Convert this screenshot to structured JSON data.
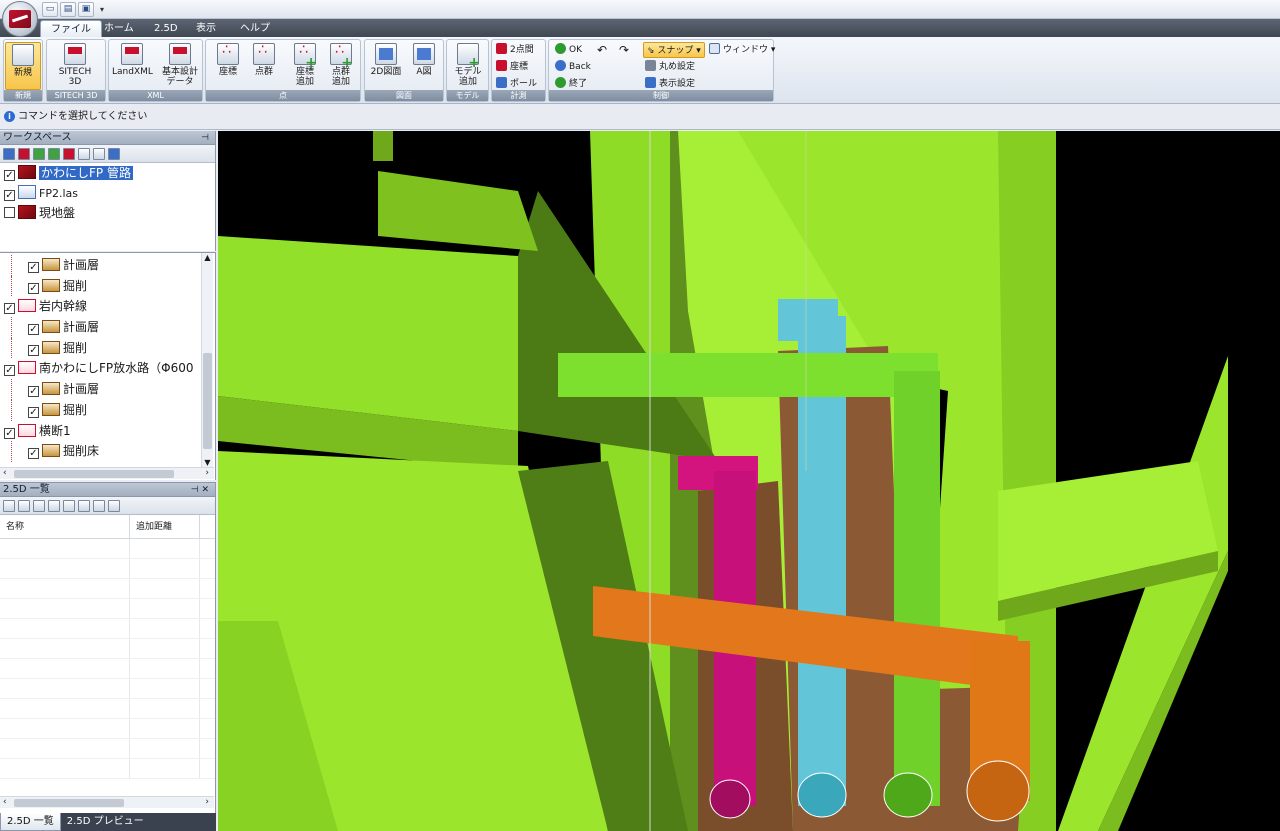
{
  "quick_access": {
    "items": [
      "new",
      "open",
      "save"
    ],
    "dropdown": "▾"
  },
  "tabs": [
    {
      "label": "ファイル",
      "active": true
    },
    {
      "label": "ホーム"
    },
    {
      "label": "2.5D"
    },
    {
      "label": "表示"
    },
    {
      "label": "ヘルプ"
    }
  ],
  "ribbon": {
    "groups": {
      "new": "新規",
      "sitech": "SITECH 3D",
      "xml": "XML",
      "point": "点",
      "drawing": "図面",
      "model": "モデル",
      "measure": "計測",
      "control": "制御"
    },
    "buttons": {
      "new": "新規",
      "sitech3d_line1": "SITECH",
      "sitech3d_line2": "3D",
      "landxml": "LandXML",
      "design_line1": "基本設計",
      "design_line2": "データ",
      "coord": "座標",
      "pointcloud": "点群",
      "coord_add_line1": "座標",
      "coord_add_line2": "追加",
      "cloud_add_line1": "点群",
      "cloud_add_line2": "追加",
      "drawing2d": "2D図面",
      "drawing_a": "A図",
      "model_add_line1": "モデル",
      "model_add_line2": "追加",
      "two_point": "2点間",
      "measure_coord": "座標",
      "pole": "ポール",
      "ok": "OK",
      "back": "Back",
      "end": "終了",
      "snap": "スナップ",
      "window": "ウィンドウ",
      "round_setting": "丸め設定",
      "display_setting": "表示設定"
    }
  },
  "command_bar": {
    "message": "コマンドを選択してください"
  },
  "workspace": {
    "title": "ワークスペース",
    "pin": "ꟷ",
    "items": [
      {
        "label": "かわにしFP 管路",
        "checked": true,
        "selected": true,
        "icon": "layer-icon"
      },
      {
        "label": "FP2.las",
        "checked": true,
        "selected": false,
        "icon": "las-file-icon"
      },
      {
        "label": "現地盤",
        "checked": false,
        "selected": false,
        "icon": "layer-icon"
      }
    ]
  },
  "tree": {
    "items": [
      {
        "label": "計画層",
        "level": 1,
        "icon": "plan-layer-icon"
      },
      {
        "label": "掘削",
        "level": 1,
        "icon": "excavation-icon"
      },
      {
        "label": "岩内幹線",
        "level": 0,
        "icon": "alignment-icon"
      },
      {
        "label": "計画層",
        "level": 1,
        "icon": "plan-layer-icon"
      },
      {
        "label": "掘削",
        "level": 1,
        "icon": "excavation-icon"
      },
      {
        "label": "南かわにしFP放水路（Φ600",
        "level": 0,
        "icon": "alignment-icon"
      },
      {
        "label": "計画層",
        "level": 1,
        "icon": "plan-layer-icon"
      },
      {
        "label": "掘削",
        "level": 1,
        "icon": "excavation-icon"
      },
      {
        "label": "横断1",
        "level": 0,
        "icon": "alignment-icon"
      },
      {
        "label": "掘削床",
        "level": 1,
        "icon": "excavation-icon"
      }
    ]
  },
  "list_panel": {
    "title": "2.5D 一覧",
    "columns": [
      "名称",
      "追加距離"
    ]
  },
  "bottom_tabs": [
    {
      "label": "2.5D 一覧",
      "active": true
    },
    {
      "label": "2.5D プレビュー",
      "active": false
    }
  ],
  "scene_colors": {
    "background": "#000000",
    "wall": "#99e62a",
    "wall_dark": "#4c7a15",
    "trench": "#8b5a34",
    "pipe_cyan": "#62c6d8",
    "pipe_green": "#6fd12a",
    "pipe_magenta": "#d3137e",
    "pipe_orange": "#e2781b"
  }
}
